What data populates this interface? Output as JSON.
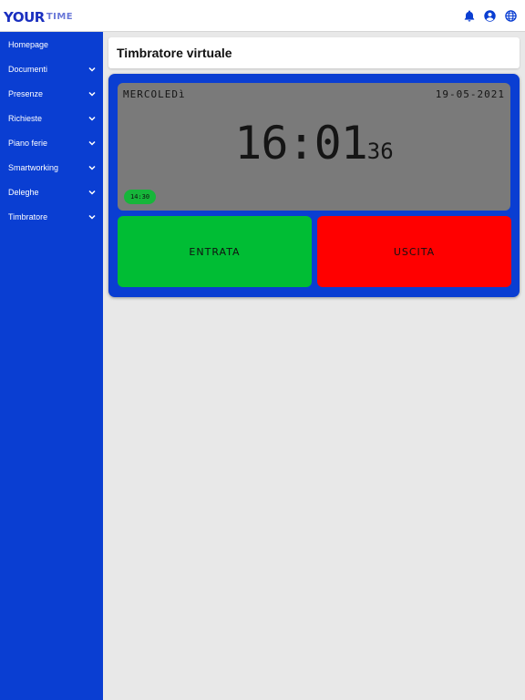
{
  "header": {
    "logo_primary": "YOUR",
    "logo_secondary": "TIME",
    "icons": [
      "bell-icon",
      "user-circle-icon",
      "globe-icon"
    ]
  },
  "sidebar": {
    "items": [
      {
        "label": "Homepage",
        "expandable": false
      },
      {
        "label": "Documenti",
        "expandable": true
      },
      {
        "label": "Presenze",
        "expandable": true
      },
      {
        "label": "Richieste",
        "expandable": true
      },
      {
        "label": "Piano ferie",
        "expandable": true
      },
      {
        "label": "Smartworking",
        "expandable": true
      },
      {
        "label": "Deleghe",
        "expandable": true
      },
      {
        "label": "Timbratore",
        "expandable": true
      }
    ]
  },
  "page": {
    "title": "Timbratore virtuale"
  },
  "clock": {
    "day": "MERCOLEDì",
    "date": "19-05-2021",
    "hours_minutes": "16:01",
    "seconds": "36",
    "last_punch": "14:30"
  },
  "actions": {
    "entry_label": "ENTRATA",
    "exit_label": "USCITA"
  },
  "colors": {
    "primary": "#0a3ed2",
    "entry": "#00bd34",
    "exit": "#ff0000",
    "display": "#7a7a7a",
    "badge": "#16b63a"
  }
}
